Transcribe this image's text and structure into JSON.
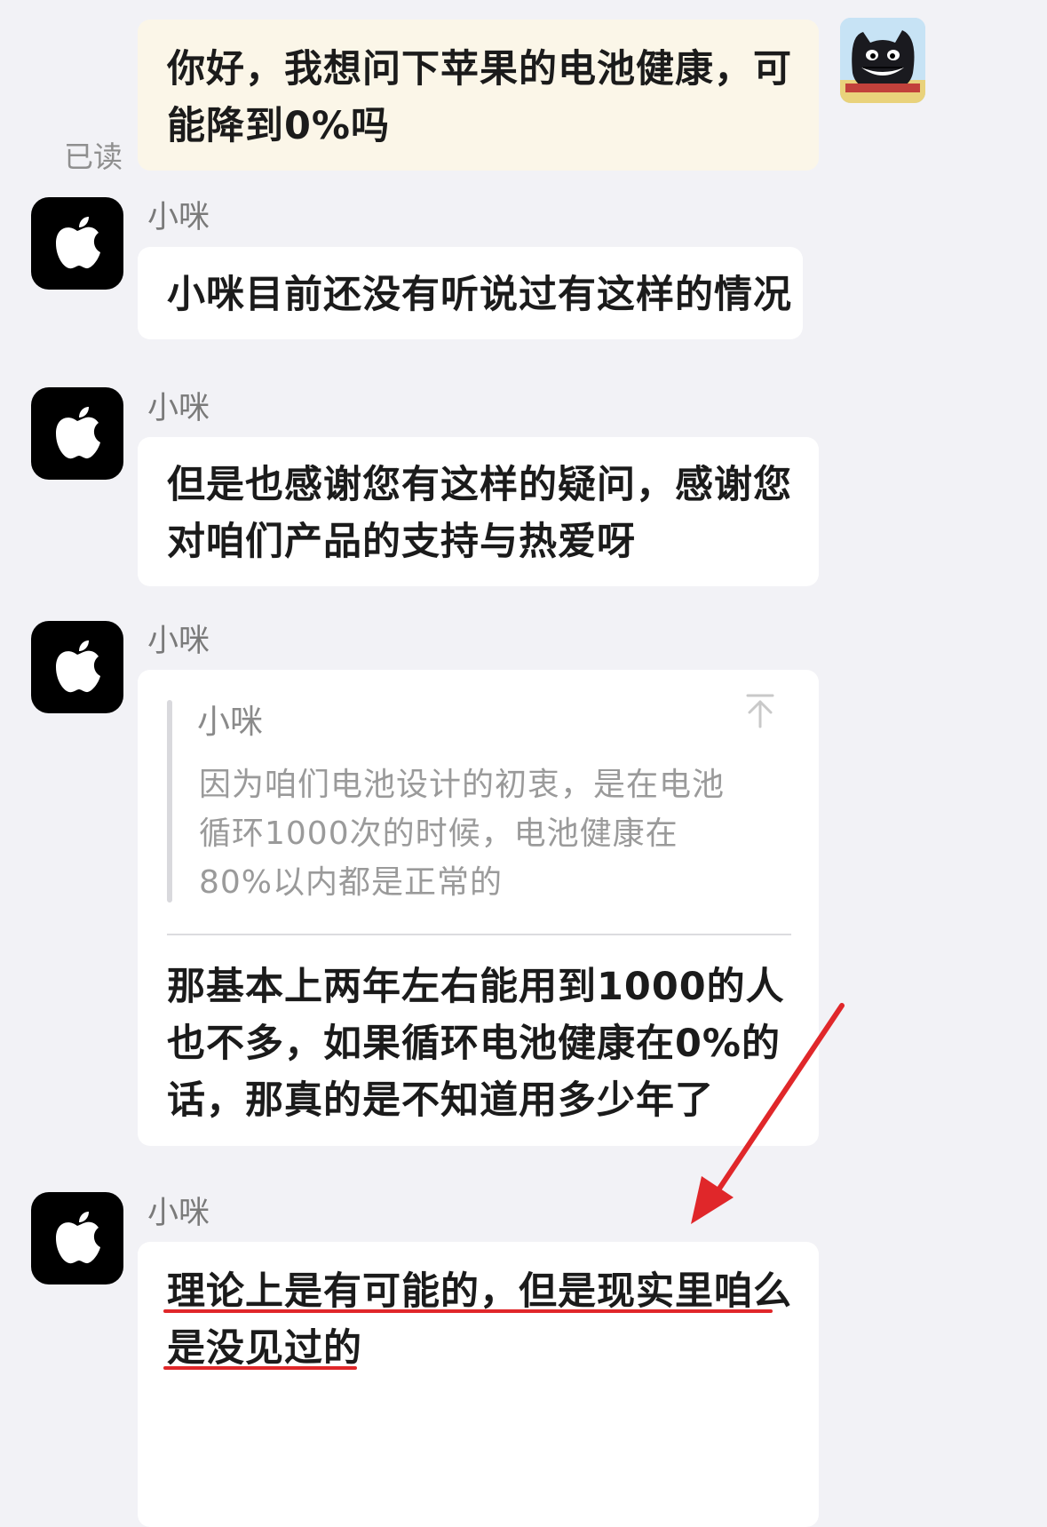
{
  "read_status": "已读",
  "my_message": {
    "line1": "你好，我想问下苹果的电池健康，可",
    "line2": "能降到0%吗"
  },
  "messages": [
    {
      "sender": "小咪",
      "lines": [
        "小咪目前还没有听说过有这样的情况"
      ]
    },
    {
      "sender": "小咪",
      "lines": [
        "但是也感谢您有这样的疑问，感谢您",
        "对咱们产品的支持与热爱呀"
      ]
    },
    {
      "sender": "小咪",
      "quote": {
        "name": "小咪",
        "lines": [
          "因为咱们电池设计的初衷，是在电池",
          "循环1000次的时候，电池健康在",
          "80%以内都是正常的"
        ]
      },
      "lines": [
        "那基本上两年左右能用到1000的人",
        "也不多，如果循环电池健康在0%的",
        "话，那真的是不知道用多少年了"
      ]
    },
    {
      "sender": "小咪",
      "lines": [
        "理论上是有可能的，但是现实里咱么",
        "是没见过的"
      ]
    }
  ],
  "icons": {
    "avatar": "apple-logo-icon",
    "quote_collapse": "arrow-up-to-top-icon",
    "user_avatar": "cat-avatar-icon"
  },
  "colors": {
    "annotation_red": "#e0272a",
    "my_bubble": "#fbf6e8"
  }
}
